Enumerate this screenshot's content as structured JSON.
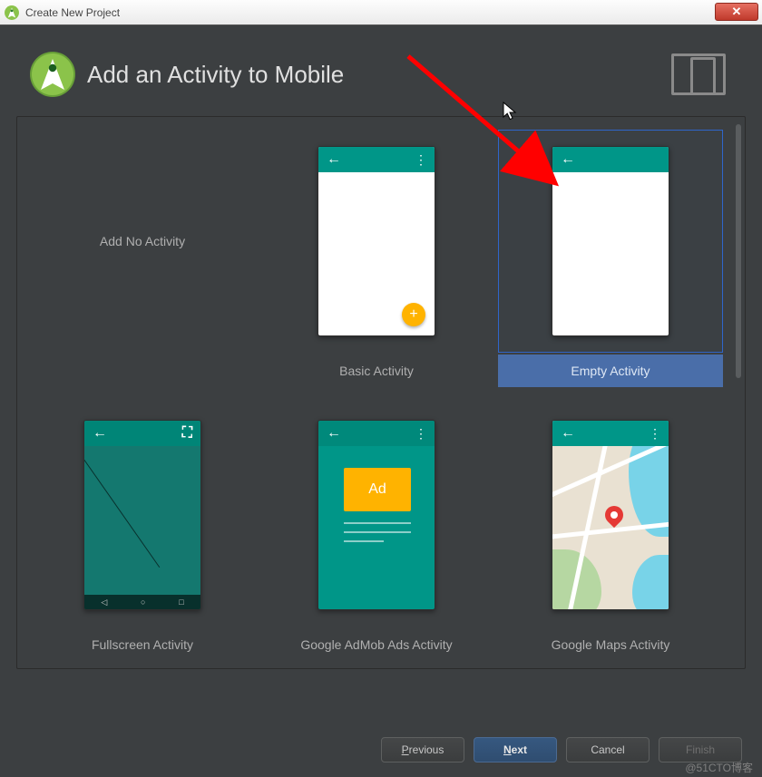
{
  "window": {
    "title": "Create New Project"
  },
  "header": {
    "title": "Add an Activity to Mobile"
  },
  "templates": [
    {
      "label": "Add No Activity",
      "type": "none",
      "selected": false
    },
    {
      "label": "Basic Activity",
      "type": "basic",
      "selected": false
    },
    {
      "label": "Empty Activity",
      "type": "empty",
      "selected": true
    },
    {
      "label": "Fullscreen Activity",
      "type": "fullscreen",
      "selected": false
    },
    {
      "label": "Google AdMob Ads Activity",
      "type": "admob",
      "selected": false
    },
    {
      "label": "Google Maps Activity",
      "type": "maps",
      "selected": false
    }
  ],
  "buttons": {
    "previous": "Previous",
    "next": "Next",
    "cancel": "Cancel",
    "finish": "Finish"
  },
  "ad_label": "Ad",
  "watermark": "@51CTO博客"
}
